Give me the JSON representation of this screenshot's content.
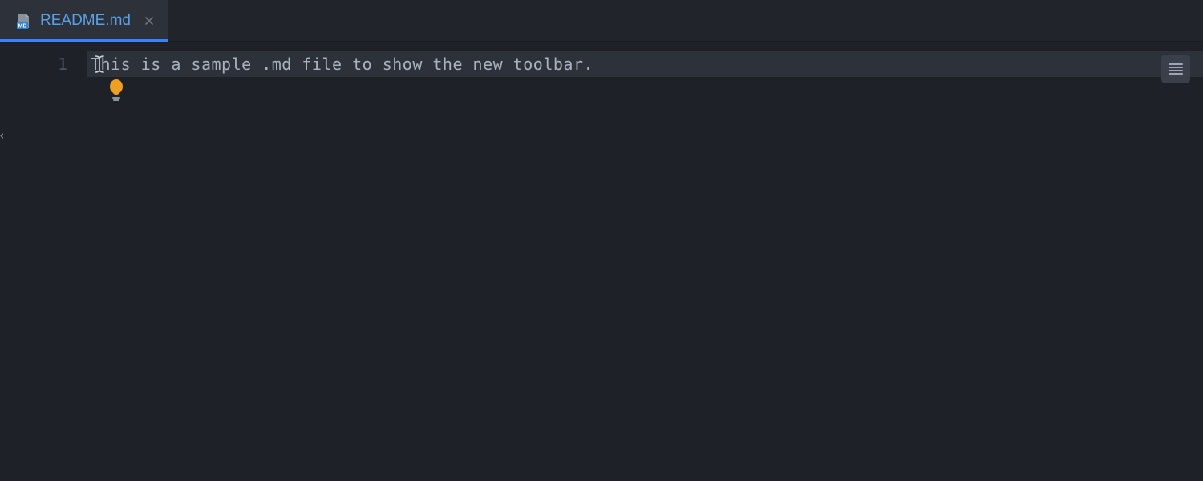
{
  "tab": {
    "filename": "README.md",
    "file_type_badge": "MD",
    "active": true
  },
  "editor": {
    "lines": [
      {
        "number": "1",
        "text": "This is a sample .md file to show the new toolbar."
      }
    ]
  },
  "colors": {
    "background": "#1e2127",
    "tab_active_bg": "#2c313a",
    "tab_underline": "#3b82f6",
    "tab_text": "#5aa0e6",
    "line_number": "#4b5261",
    "code_text": "#abb2bf",
    "lightbulb": "#f0a020"
  }
}
